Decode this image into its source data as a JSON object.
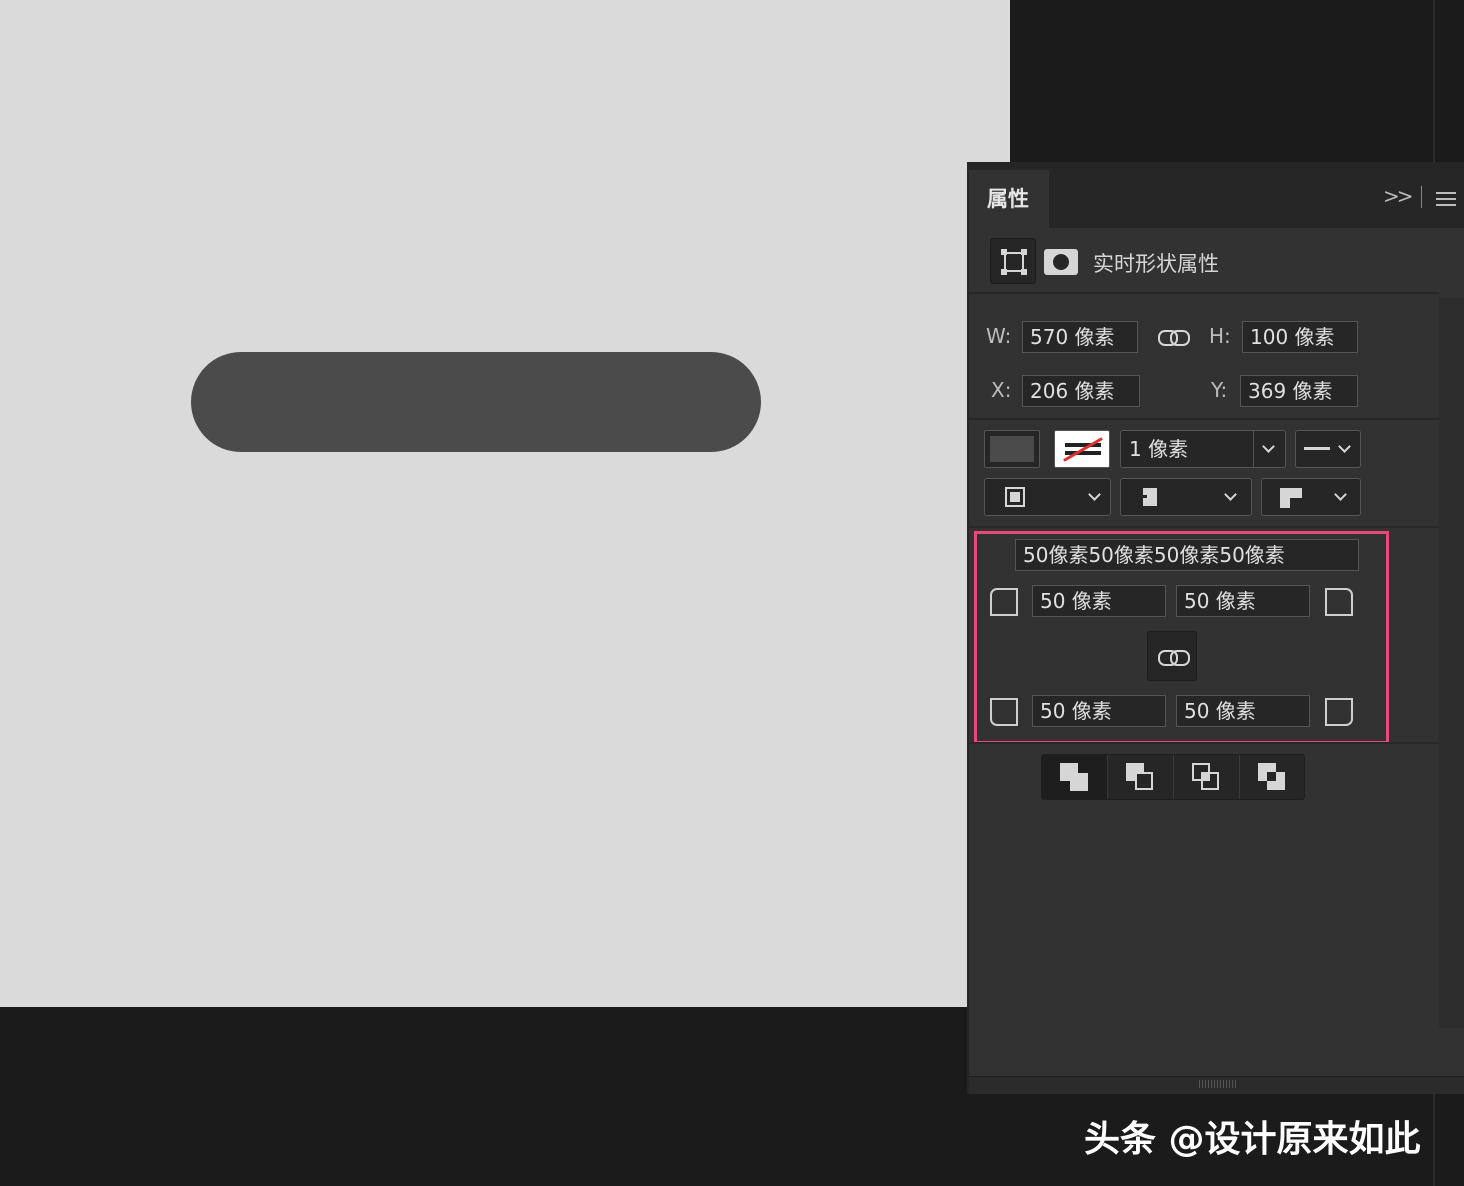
{
  "canvas": {
    "shape_color": "#4b4b4b",
    "background_color": "#dadada"
  },
  "panel": {
    "tab_label": "属性",
    "collapse_icon": "double-chevron-right-icon",
    "menu_icon": "hamburger-menu-icon",
    "section_title": "实时形状属性",
    "dimensions": {
      "w_label": "W:",
      "w_value": "570 像素",
      "h_label": "H:",
      "h_value": "100 像素",
      "x_label": "X:",
      "x_value": "206 像素",
      "y_label": "Y:",
      "y_value": "369 像素"
    },
    "appearance": {
      "fill_color": "#4b4b4b",
      "stroke_width": "1 像素"
    },
    "corners": {
      "all_radii": "50像素50像素50像素50像素",
      "top_left": "50 像素",
      "top_right": "50 像素",
      "bottom_left": "50 像素",
      "bottom_right": "50 像素"
    },
    "highlight_color": "#e8487a"
  },
  "watermark": "头条 @设计原来如此"
}
